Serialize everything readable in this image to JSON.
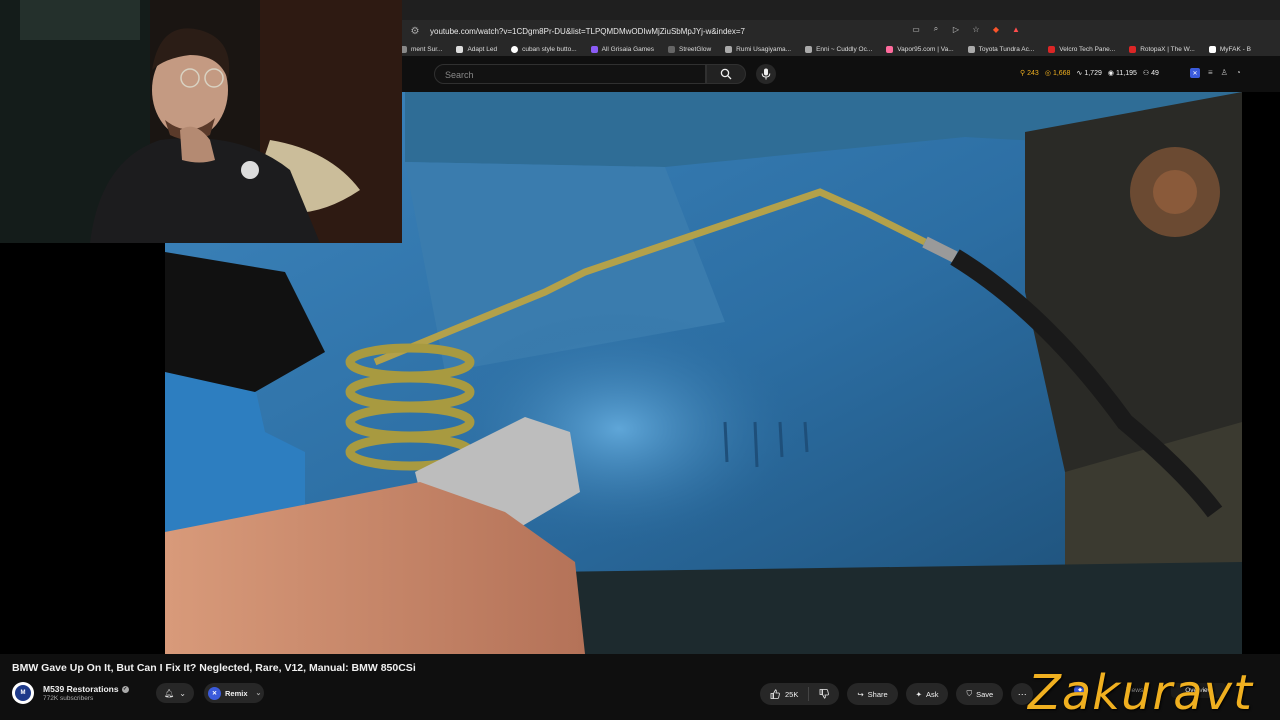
{
  "browser": {
    "url": "youtube.com/watch?v=1CDgm8Pr-DU&list=TLPQMDMwODIwMjZiuSbMpJYj-w&index=7",
    "bookmarks": [
      {
        "label": "ment Sur...",
        "color": "#888888"
      },
      {
        "label": "Adapt Led",
        "color": "#dddddd"
      },
      {
        "label": "cuban style butto...",
        "color": "#ffffff"
      },
      {
        "label": "All Grisaia Games",
        "color": "#8b5cf6"
      },
      {
        "label": "StreetGlow",
        "color": "#666666"
      },
      {
        "label": "Rumi Usagiyama...",
        "color": "#aaaaaa"
      },
      {
        "label": "Enni ~ Cuddly Oc...",
        "color": "#aaaaaa"
      },
      {
        "label": "Vapor95.com | Va...",
        "color": "#ff6b9d"
      },
      {
        "label": "Toyota Tundra Ac...",
        "color": "#aaaaaa"
      },
      {
        "label": "Velcro Tech Pane...",
        "color": "#dc2626"
      },
      {
        "label": "RotopaX | The W...",
        "color": "#dc2626"
      },
      {
        "label": "MyFAK - B",
        "color": "#ffffff"
      }
    ]
  },
  "header": {
    "search_placeholder": "Search",
    "stats": [
      {
        "icon": "person-icon",
        "value": "243",
        "color": "#f0b020"
      },
      {
        "icon": "coin-icon",
        "value": "1,668",
        "color": "#f0b020"
      },
      {
        "icon": "chart-icon",
        "value": "1,729",
        "color": "#ffffff"
      },
      {
        "icon": "eye-icon",
        "value": "11,195",
        "color": "#ffffff"
      },
      {
        "icon": "users-icon",
        "value": "49",
        "color": "#ffffff"
      }
    ]
  },
  "video": {
    "title": "BMW Gave Up On It, But Can I Fix It? Neglected, Rare, V12, Manual: BMW 850CSi"
  },
  "channel": {
    "name": "M539 Restorations",
    "subscribers": "772K subscribers",
    "remix_label": "Remix"
  },
  "actions": {
    "likes": "25K",
    "share_label": "Share",
    "ask_label": "Ask",
    "save_label": "Save"
  },
  "side_tabs": {
    "views_label": "Views",
    "overview_label": "Overview"
  },
  "watermark": "Zakuravt"
}
